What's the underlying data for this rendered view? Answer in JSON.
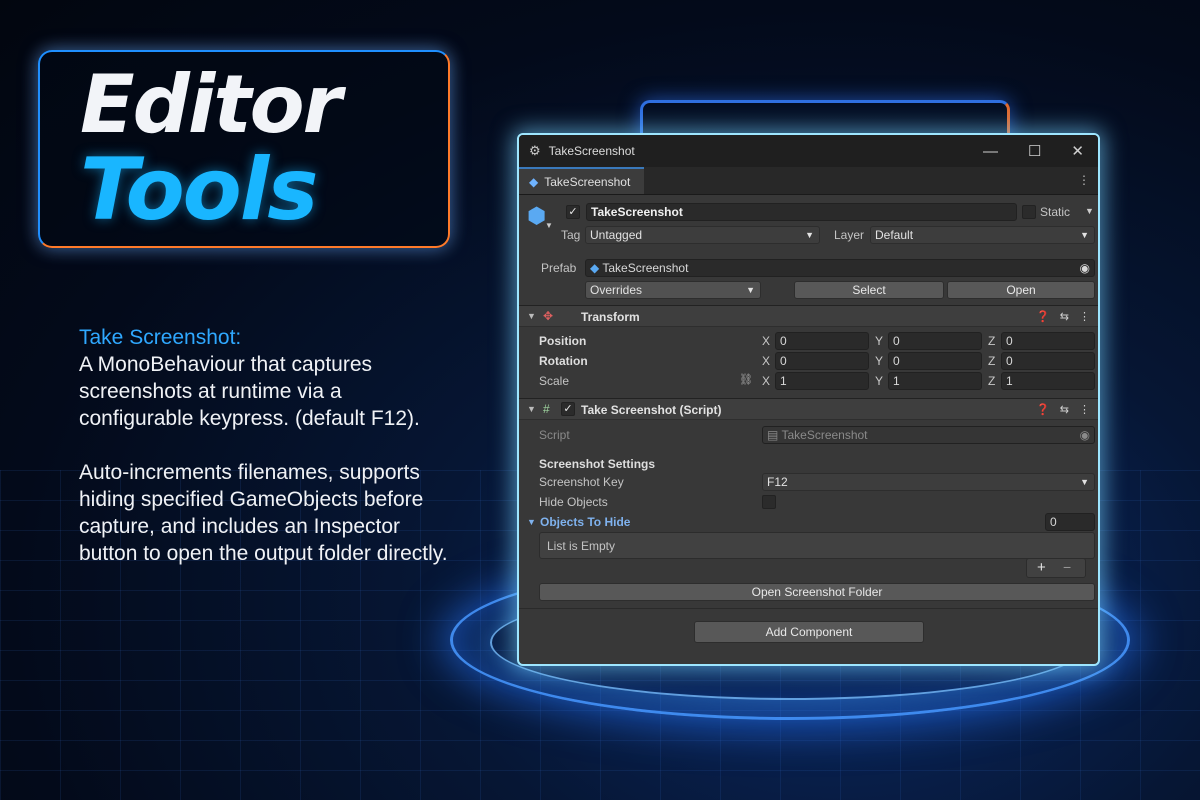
{
  "hero": {
    "title_line1": "Editor",
    "title_line2": "Tools"
  },
  "description": {
    "heading": "Take Screenshot:",
    "paragraph1": "A MonoBehaviour that captures screenshots at runtime via a configurable keypress. (default F12).",
    "paragraph2": "Auto-increments filenames, supports hiding specified GameObjects before capture, and includes an Inspector button to open the output folder directly."
  },
  "window": {
    "title": "TakeScreenshot",
    "tab_label": "TakeScreenshot",
    "gameobject": {
      "name": "TakeScreenshot",
      "static_label": "Static",
      "tag_label": "Tag",
      "tag_value": "Untagged",
      "layer_label": "Layer",
      "layer_value": "Default",
      "prefab_label": "Prefab",
      "prefab_value": "TakeScreenshot",
      "overrides_label": "Overrides",
      "select_label": "Select",
      "open_label": "Open"
    },
    "transform": {
      "header": "Transform",
      "rows": [
        {
          "label": "Position",
          "x": "0",
          "y": "0",
          "z": "0"
        },
        {
          "label": "Rotation",
          "x": "0",
          "y": "0",
          "z": "0"
        },
        {
          "label": "Scale",
          "x": "1",
          "y": "1",
          "z": "1"
        }
      ],
      "axis_x": "X",
      "axis_y": "Y",
      "axis_z": "Z"
    },
    "script_component": {
      "header": "Take Screenshot (Script)",
      "script_label": "Script",
      "script_value": "TakeScreenshot",
      "settings_heading": "Screenshot Settings",
      "key_label": "Screenshot Key",
      "key_value": "F12",
      "hide_objects_label": "Hide Objects",
      "objects_to_hide_label": "Objects To Hide",
      "objects_to_hide_count": "0",
      "list_empty_text": "List is Empty",
      "plus": "+",
      "minus": "−",
      "open_folder_label": "Open Screenshot Folder"
    },
    "add_component_label": "Add Component"
  },
  "colors": {
    "accent_blue": "#19b6ff",
    "accent_orange": "#ff7a2a",
    "window_border": "#9ee6ff"
  }
}
